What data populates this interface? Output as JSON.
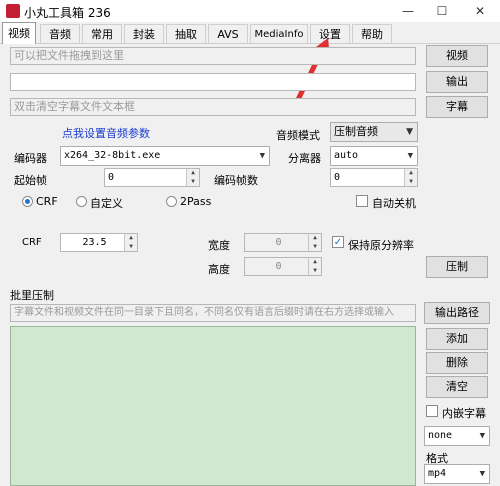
{
  "window": {
    "title": "小丸工具箱 236",
    "controls": [
      "—",
      "☐",
      "✕"
    ]
  },
  "tabs": [
    "视频",
    "音频",
    "常用",
    "封装",
    "抽取",
    "AVS",
    "MediaInfo",
    "设置",
    "帮助"
  ],
  "video": {
    "drag_placeholder": "可以把文件拖拽到这里",
    "output_value": "",
    "subtitle_placeholder": "双击清空字幕文件文本框",
    "btn_video": "视频",
    "btn_output": "输出",
    "btn_subtitle": "字幕",
    "link_audio_params": "点我设置音频参数",
    "label_audio_mode": "音频模式",
    "audio_mode_value": "压制音频",
    "label_encoder": "编码器",
    "encoder_value": "x264_32-8bit.exe",
    "label_splitter": "分离器",
    "splitter_value": "auto",
    "label_start_frame": "起始帧",
    "start_frame_value": "0",
    "label_encode_frames": "编码帧数",
    "encode_frames_value": "0",
    "radio_crf": "CRF",
    "radio_custom": "自定义",
    "radio_2pass": "2Pass",
    "auto_shutdown_label": "自动关机",
    "crf_label": "CRF",
    "crf_value": "23.5",
    "width_label": "宽度",
    "width_value": "0",
    "height_label": "高度",
    "height_value": "0",
    "keep_res_label": "保持原分辨率",
    "btn_encode": "压制"
  },
  "batch": {
    "section_label": "批里压制",
    "hint_placeholder": "字幕文件和视频文件在同一目录下且同名，不同名仅有语言后缀时请在右方选择或输入",
    "btn_output_path": "输出路径",
    "btn_add": "添加",
    "btn_delete": "删除",
    "btn_clear": "清空",
    "embed_sub_label": "内嵌字幕",
    "lang_value": "none",
    "format_label": "格式",
    "format_value": "mp4"
  },
  "colors": {
    "arrow": "#e03030",
    "list_bg": "#cfe8cf",
    "link": "#1a3cd0"
  }
}
